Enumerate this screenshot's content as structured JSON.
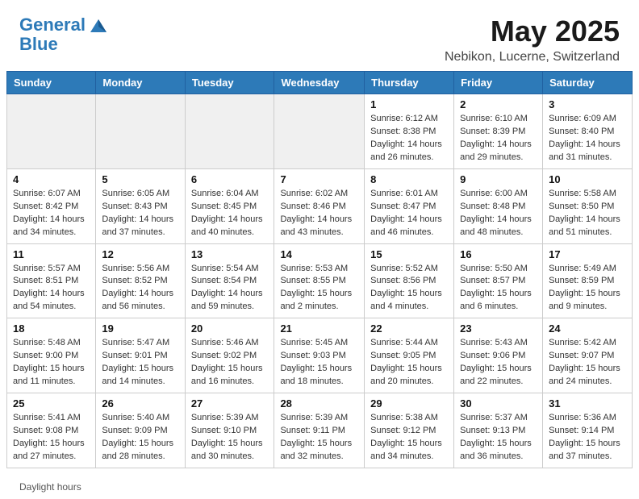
{
  "header": {
    "logo_line1": "General",
    "logo_line2": "Blue",
    "month": "May 2025",
    "location": "Nebikon, Lucerne, Switzerland"
  },
  "weekdays": [
    "Sunday",
    "Monday",
    "Tuesday",
    "Wednesday",
    "Thursday",
    "Friday",
    "Saturday"
  ],
  "weeks": [
    [
      {
        "day": "",
        "empty": true
      },
      {
        "day": "",
        "empty": true
      },
      {
        "day": "",
        "empty": true
      },
      {
        "day": "",
        "empty": true
      },
      {
        "day": "1",
        "sunrise": "6:12 AM",
        "sunset": "8:38 PM",
        "daylight": "14 hours and 26 minutes."
      },
      {
        "day": "2",
        "sunrise": "6:10 AM",
        "sunset": "8:39 PM",
        "daylight": "14 hours and 29 minutes."
      },
      {
        "day": "3",
        "sunrise": "6:09 AM",
        "sunset": "8:40 PM",
        "daylight": "14 hours and 31 minutes."
      }
    ],
    [
      {
        "day": "4",
        "sunrise": "6:07 AM",
        "sunset": "8:42 PM",
        "daylight": "14 hours and 34 minutes."
      },
      {
        "day": "5",
        "sunrise": "6:05 AM",
        "sunset": "8:43 PM",
        "daylight": "14 hours and 37 minutes."
      },
      {
        "day": "6",
        "sunrise": "6:04 AM",
        "sunset": "8:45 PM",
        "daylight": "14 hours and 40 minutes."
      },
      {
        "day": "7",
        "sunrise": "6:02 AM",
        "sunset": "8:46 PM",
        "daylight": "14 hours and 43 minutes."
      },
      {
        "day": "8",
        "sunrise": "6:01 AM",
        "sunset": "8:47 PM",
        "daylight": "14 hours and 46 minutes."
      },
      {
        "day": "9",
        "sunrise": "6:00 AM",
        "sunset": "8:48 PM",
        "daylight": "14 hours and 48 minutes."
      },
      {
        "day": "10",
        "sunrise": "5:58 AM",
        "sunset": "8:50 PM",
        "daylight": "14 hours and 51 minutes."
      }
    ],
    [
      {
        "day": "11",
        "sunrise": "5:57 AM",
        "sunset": "8:51 PM",
        "daylight": "14 hours and 54 minutes."
      },
      {
        "day": "12",
        "sunrise": "5:56 AM",
        "sunset": "8:52 PM",
        "daylight": "14 hours and 56 minutes."
      },
      {
        "day": "13",
        "sunrise": "5:54 AM",
        "sunset": "8:54 PM",
        "daylight": "14 hours and 59 minutes."
      },
      {
        "day": "14",
        "sunrise": "5:53 AM",
        "sunset": "8:55 PM",
        "daylight": "15 hours and 2 minutes."
      },
      {
        "day": "15",
        "sunrise": "5:52 AM",
        "sunset": "8:56 PM",
        "daylight": "15 hours and 4 minutes."
      },
      {
        "day": "16",
        "sunrise": "5:50 AM",
        "sunset": "8:57 PM",
        "daylight": "15 hours and 6 minutes."
      },
      {
        "day": "17",
        "sunrise": "5:49 AM",
        "sunset": "8:59 PM",
        "daylight": "15 hours and 9 minutes."
      }
    ],
    [
      {
        "day": "18",
        "sunrise": "5:48 AM",
        "sunset": "9:00 PM",
        "daylight": "15 hours and 11 minutes."
      },
      {
        "day": "19",
        "sunrise": "5:47 AM",
        "sunset": "9:01 PM",
        "daylight": "15 hours and 14 minutes."
      },
      {
        "day": "20",
        "sunrise": "5:46 AM",
        "sunset": "9:02 PM",
        "daylight": "15 hours and 16 minutes."
      },
      {
        "day": "21",
        "sunrise": "5:45 AM",
        "sunset": "9:03 PM",
        "daylight": "15 hours and 18 minutes."
      },
      {
        "day": "22",
        "sunrise": "5:44 AM",
        "sunset": "9:05 PM",
        "daylight": "15 hours and 20 minutes."
      },
      {
        "day": "23",
        "sunrise": "5:43 AM",
        "sunset": "9:06 PM",
        "daylight": "15 hours and 22 minutes."
      },
      {
        "day": "24",
        "sunrise": "5:42 AM",
        "sunset": "9:07 PM",
        "daylight": "15 hours and 24 minutes."
      }
    ],
    [
      {
        "day": "25",
        "sunrise": "5:41 AM",
        "sunset": "9:08 PM",
        "daylight": "15 hours and 27 minutes."
      },
      {
        "day": "26",
        "sunrise": "5:40 AM",
        "sunset": "9:09 PM",
        "daylight": "15 hours and 28 minutes."
      },
      {
        "day": "27",
        "sunrise": "5:39 AM",
        "sunset": "9:10 PM",
        "daylight": "15 hours and 30 minutes."
      },
      {
        "day": "28",
        "sunrise": "5:39 AM",
        "sunset": "9:11 PM",
        "daylight": "15 hours and 32 minutes."
      },
      {
        "day": "29",
        "sunrise": "5:38 AM",
        "sunset": "9:12 PM",
        "daylight": "15 hours and 34 minutes."
      },
      {
        "day": "30",
        "sunrise": "5:37 AM",
        "sunset": "9:13 PM",
        "daylight": "15 hours and 36 minutes."
      },
      {
        "day": "31",
        "sunrise": "5:36 AM",
        "sunset": "9:14 PM",
        "daylight": "15 hours and 37 minutes."
      }
    ]
  ],
  "footer": {
    "daylight_label": "Daylight hours"
  }
}
